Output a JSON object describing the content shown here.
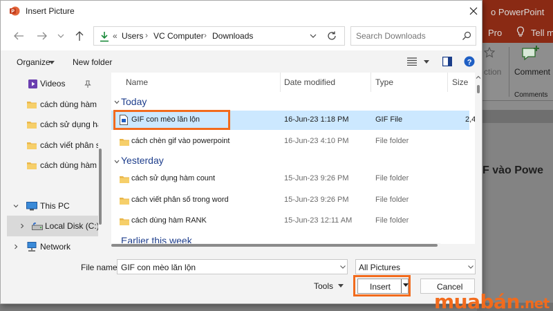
{
  "powerpoint_background": {
    "title_fragment": "o PowerPoint",
    "tab_pro": "Pro",
    "tab_tell": "Tell m",
    "action_fragment": "ction",
    "comment_button": "Comment",
    "comments_group": "Comments",
    "slide_heading_fragment": "F vào Powe"
  },
  "dialog": {
    "title": "Insert Picture",
    "close_icon": "close-icon"
  },
  "address": {
    "chevrons": "«",
    "crumbs": [
      "Users",
      "VC Computer",
      "Downloads"
    ],
    "separator": "›",
    "search_placeholder": "Search Downloads"
  },
  "toolbar": {
    "organize": "Organize",
    "new_folder": "New folder"
  },
  "nav_pane": {
    "items": [
      {
        "label": "Videos",
        "icon": "videos-icon",
        "pinned": true
      },
      {
        "label": "cách dùng hàm",
        "icon": "folder-icon"
      },
      {
        "label": "cách sử dụng hà",
        "icon": "folder-icon"
      },
      {
        "label": "cách viết phân s",
        "icon": "folder-icon"
      },
      {
        "label": "cách dùng hàm",
        "icon": "folder-icon"
      },
      {
        "label": "This PC",
        "icon": "pc-icon"
      },
      {
        "label": "Local Disk (C:)",
        "icon": "drive-icon"
      },
      {
        "label": "Network",
        "icon": "network-icon"
      }
    ]
  },
  "file_list": {
    "columns": [
      "Name",
      "Date modified",
      "Type",
      "Size"
    ],
    "groups": [
      {
        "name": "Today",
        "rows": [
          {
            "name": "GIF con mèo lăn lộn",
            "date": "16-Jun-23 1:18 PM",
            "type": "GIF File",
            "size": "2,4",
            "icon": "gif-file-icon",
            "selected": true
          },
          {
            "name": "cách chèn gif vào powerpoint",
            "date": "16-Jun-23 4:10 PM",
            "type": "File folder",
            "size": "",
            "icon": "folder-icon"
          }
        ]
      },
      {
        "name": "Yesterday",
        "rows": [
          {
            "name": "cách sử dụng hàm count",
            "date": "15-Jun-23 9:26 PM",
            "type": "File folder",
            "size": "",
            "icon": "folder-icon"
          },
          {
            "name": "cách viết phân số trong word",
            "date": "15-Jun-23 9:26 PM",
            "type": "File folder",
            "size": "",
            "icon": "folder-icon"
          },
          {
            "name": "cách dùng hàm RANK",
            "date": "15-Jun-23 12:11 AM",
            "type": "File folder",
            "size": "",
            "icon": "folder-icon"
          }
        ]
      },
      {
        "name": "Earlier this week",
        "rows": []
      }
    ]
  },
  "bottom": {
    "file_name_label": "File name:",
    "file_name_value": "GIF con mèo lăn lộn",
    "file_type_value": "All Pictures",
    "tools": "Tools",
    "insert": "Insert",
    "cancel": "Cancel"
  },
  "watermark": {
    "brand": "muabán",
    "suffix": ".net"
  },
  "colors": {
    "highlight": "#f26b1d",
    "selection": "#cce8ff",
    "group_header": "#1e3e8c",
    "ppt_brand": "#8a2a14"
  }
}
